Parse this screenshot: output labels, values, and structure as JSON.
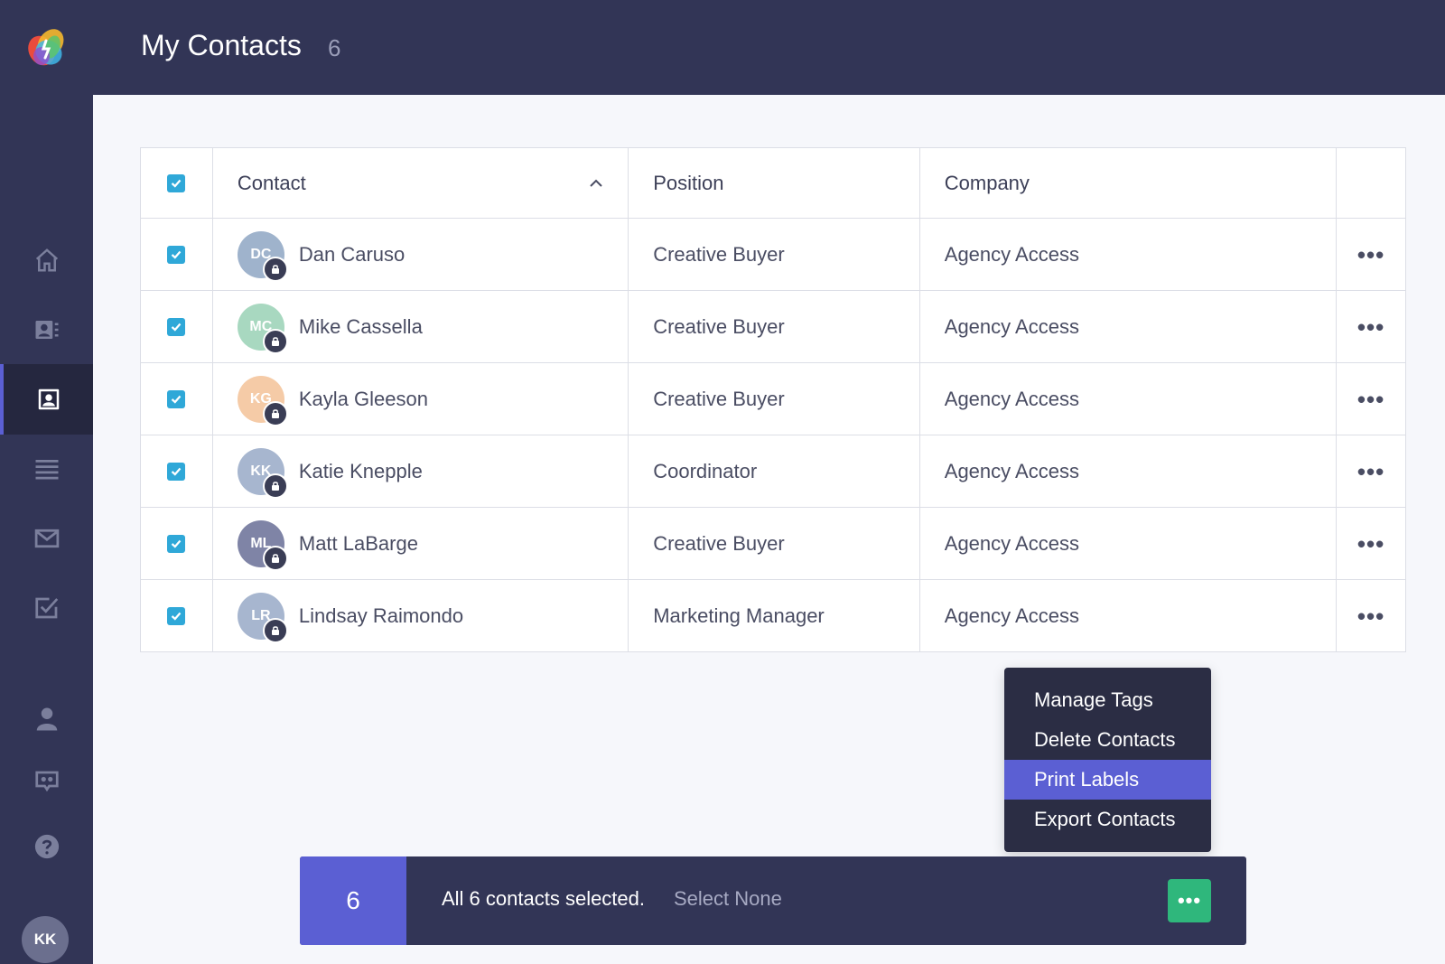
{
  "header": {
    "title": "My Contacts",
    "count": "6"
  },
  "sidebar": {
    "items": [
      {
        "icon": "home-icon",
        "active": false
      },
      {
        "icon": "contact-card-icon",
        "active": false
      },
      {
        "icon": "contact-book-icon",
        "active": true
      },
      {
        "icon": "list-icon",
        "active": false
      },
      {
        "icon": "mail-icon",
        "active": false
      },
      {
        "icon": "task-check-icon",
        "active": false
      },
      {
        "icon": "person-icon",
        "active": false
      },
      {
        "icon": "chat-icon",
        "active": false
      },
      {
        "icon": "help-icon",
        "active": false
      }
    ],
    "user_initials": "KK"
  },
  "table": {
    "columns": [
      "Contact",
      "Position",
      "Company"
    ],
    "sort_column": "Contact",
    "sort_direction": "ascending",
    "rows": [
      {
        "initials": "DC",
        "name": "Dan Caruso",
        "position": "Creative Buyer",
        "company": "Agency Access",
        "avatar_color": "#9fb3cc",
        "checked": true
      },
      {
        "initials": "MC",
        "name": "Mike Cassella",
        "position": "Creative Buyer",
        "company": "Agency Access",
        "avatar_color": "#a8d8c0",
        "checked": true
      },
      {
        "initials": "KG",
        "name": "Kayla Gleeson",
        "position": "Creative Buyer",
        "company": "Agency Access",
        "avatar_color": "#f5cba7",
        "checked": true
      },
      {
        "initials": "KK",
        "name": "Katie Knepple",
        "position": "Coordinator",
        "company": "Agency Access",
        "avatar_color": "#a7b6cf",
        "checked": true
      },
      {
        "initials": "ML",
        "name": "Matt LaBarge",
        "position": "Creative Buyer",
        "company": "Agency Access",
        "avatar_color": "#7f84a6",
        "checked": true
      },
      {
        "initials": "LR",
        "name": "Lindsay Raimondo",
        "position": "Marketing Manager",
        "company": "Agency Access",
        "avatar_color": "#a7b6cf",
        "checked": true
      }
    ]
  },
  "menu": {
    "items": [
      "Manage Tags",
      "Delete Contacts",
      "Print Labels",
      "Export Contacts"
    ],
    "highlighted": "Print Labels"
  },
  "selection_bar": {
    "count": "6",
    "message": "All 6 contacts selected.",
    "select_none": "Select None",
    "more_label": "•••"
  },
  "colors": {
    "nav_bg": "#323556",
    "accent": "#5b5fd3",
    "checkbox": "#2fa8d8",
    "action_green": "#2fb77c"
  }
}
